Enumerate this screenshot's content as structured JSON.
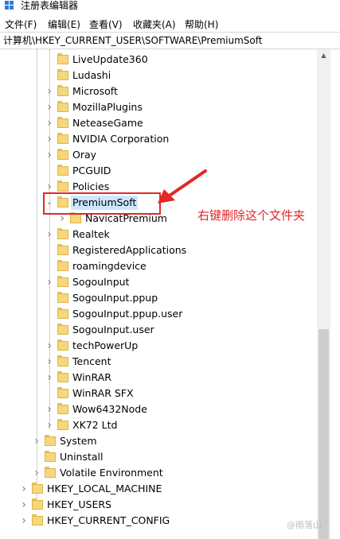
{
  "window": {
    "title": "注册表编辑器"
  },
  "menu": [
    "文件(F)",
    "编辑(E)",
    "查看(V)",
    "收藏夹(A)",
    "帮助(H)"
  ],
  "address": "计算机\\HKEY_CURRENT_USER\\SOFTWARE\\PremiumSoft",
  "tree": [
    "LiveUpdate360",
    "Ludashi",
    "Microsoft",
    "MozillaPlugins",
    "NeteaseGame",
    "NVIDIA Corporation",
    "Oray",
    "PCGUID",
    "Policies",
    "PremiumSoft",
    "NavicatPremium",
    "Realtek",
    "RegisteredApplications",
    "roamingdevice",
    "SogouInput",
    "SogouInput.ppup",
    "SogouInput.ppup.user",
    "SogouInput.user",
    "techPowerUp",
    "Tencent",
    "WinRAR",
    "WinRAR SFX",
    "Wow6432Node",
    "XK72 Ltd",
    "System",
    "Uninstall",
    "Volatile Environment",
    "HKEY_LOCAL_MACHINE",
    "HKEY_USERS",
    "HKEY_CURRENT_CONFIG"
  ],
  "annotation": "右键删除这个文件夹",
  "watermark": "@雨落山",
  "colors": {
    "annotation": "#e02828",
    "selection": "#cce8ff",
    "folder": "#f6d77a"
  },
  "icons": {
    "expanded": "chevron-down-icon",
    "collapsed": "chevron-right-icon",
    "folder": "folder-icon"
  }
}
